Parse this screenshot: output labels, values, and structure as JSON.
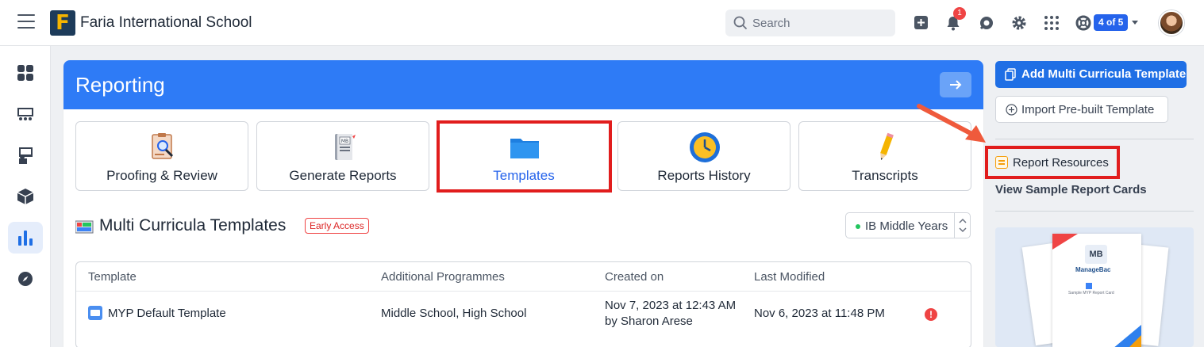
{
  "app": {
    "school_name": "Faria International School",
    "logo_letter": "F"
  },
  "topbar": {
    "search_placeholder": "Search",
    "notification_count": "1",
    "account_pill": "4 of 5"
  },
  "sidebar": {
    "items": [
      "dashboard",
      "classes",
      "teachers",
      "packages",
      "reports",
      "discover"
    ],
    "active": "reports"
  },
  "reporting": {
    "title": "Reporting",
    "tiles": [
      {
        "label": "Proofing & Review"
      },
      {
        "label": "Generate Reports"
      },
      {
        "label": "Templates"
      },
      {
        "label": "Reports History"
      },
      {
        "label": "Transcripts"
      }
    ],
    "section_title": "Multi Curricula Templates",
    "early_access": "Early Access",
    "programme_select": "IB Middle Years",
    "table": {
      "headers": [
        "Template",
        "Additional Programmes",
        "Created on",
        "Last Modified"
      ],
      "rows": [
        {
          "template": "MYP Default Template",
          "programmes": "Middle School, High School",
          "created_line1": "Nov 7, 2023 at 12:43 AM",
          "created_line2": "by Sharon Arese",
          "modified": "Nov 6, 2023 at 11:48 PM",
          "warning": "!"
        }
      ]
    }
  },
  "right_panel": {
    "add_button": "Add Multi Curricula Template",
    "import_button": "Import Pre-built Template",
    "resources_link": "Report Resources",
    "sample_link": "View Sample Report Cards",
    "preview": {
      "logo": "MB",
      "brand": "ManageBac",
      "caption": "Sample MYP Report Card"
    }
  },
  "colors": {
    "header_blue": "#2e7bf6",
    "accent_blue": "#2563eb",
    "highlight_red": "#e11d1d",
    "badge_red": "#ef4444"
  }
}
